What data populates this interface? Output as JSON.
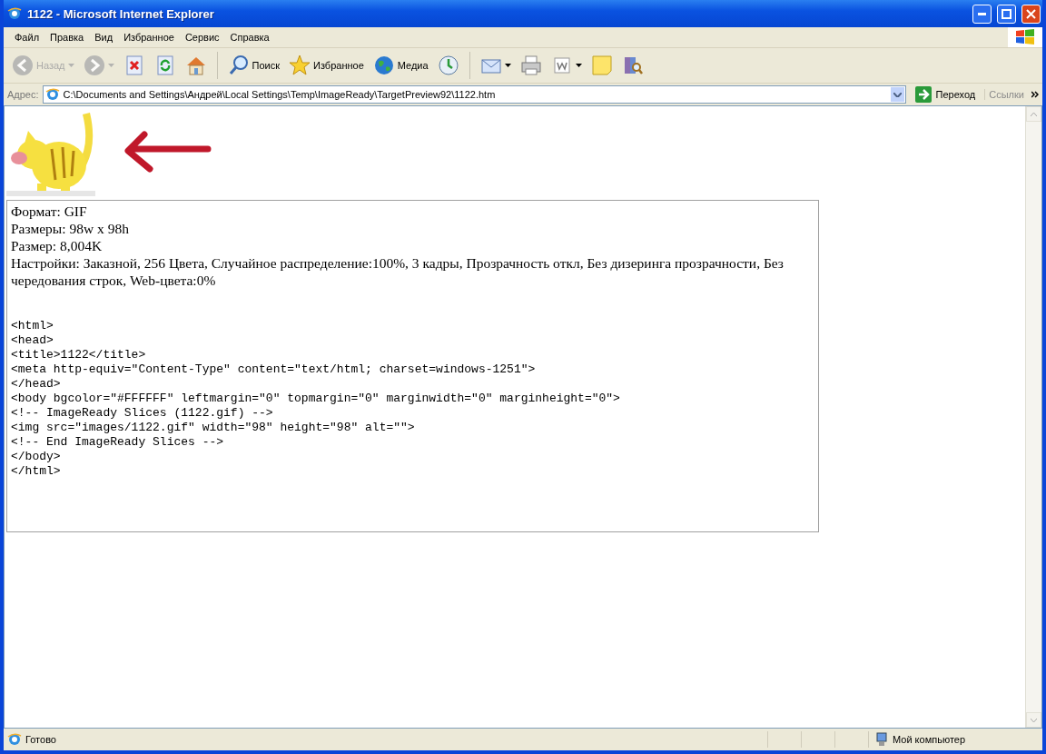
{
  "window": {
    "title": "1122 - Microsoft Internet Explorer"
  },
  "menu": [
    {
      "label": "Файл"
    },
    {
      "label": "Правка"
    },
    {
      "label": "Вид"
    },
    {
      "label": "Избранное"
    },
    {
      "label": "Сервис"
    },
    {
      "label": "Справка"
    }
  ],
  "toolbar": [
    {
      "kind": "back",
      "label": "Назад",
      "disabled": true,
      "dropdown": true
    },
    {
      "kind": "forward",
      "disabled": true,
      "dropdown": true
    },
    {
      "kind": "stop",
      "disabled": false
    },
    {
      "kind": "refresh",
      "disabled": false
    },
    {
      "kind": "home",
      "disabled": false
    },
    {
      "kind": "separator"
    },
    {
      "kind": "search",
      "label": "Поиск",
      "disabled": false
    },
    {
      "kind": "favorites",
      "label": "Избранное",
      "disabled": false
    },
    {
      "kind": "media",
      "label": "Медиа",
      "disabled": false
    },
    {
      "kind": "history",
      "disabled": false
    },
    {
      "kind": "separator"
    },
    {
      "kind": "mail",
      "disabled": false,
      "dropdown": true
    },
    {
      "kind": "print",
      "disabled": false
    },
    {
      "kind": "edit",
      "disabled": false,
      "dropdown": true
    },
    {
      "kind": "note",
      "disabled": false
    },
    {
      "kind": "research",
      "disabled": false
    }
  ],
  "address": {
    "label": "Адрес:",
    "value": "C:\\Documents and Settings\\Андрей\\Local Settings\\Temp\\ImageReady\\TargetPreview92\\1122.htm",
    "go": "Переход",
    "links": "Ссылки"
  },
  "page": {
    "info": [
      "Формат: GIF",
      "Размеры: 98w x 98h",
      "Размер: 8,004K",
      "Настройки: Заказной, 256 Цвета, Случайное распределение:100%, 3 кадры, Прозрачность откл, Без дизеринга прозрачности, Без чередования строк, Web-цвета:0%"
    ],
    "code": [
      "<html>",
      "<head>",
      "<title>1122</title>",
      "<meta http-equiv=\"Content-Type\" content=\"text/html; charset=windows-1251\">",
      "</head>",
      "<body bgcolor=\"#FFFFFF\" leftmargin=\"0\" topmargin=\"0\" marginwidth=\"0\" marginheight=\"0\">",
      "<!-- ImageReady Slices (1122.gif) -->",
      "<img src=\"images/1122.gif\" width=\"98\" height=\"98\" alt=\"\">",
      "<!-- End ImageReady Slices -->",
      "</body>",
      "</html>"
    ]
  },
  "status_bar": {
    "text": "Готово",
    "zone": "Мой компьютер"
  }
}
